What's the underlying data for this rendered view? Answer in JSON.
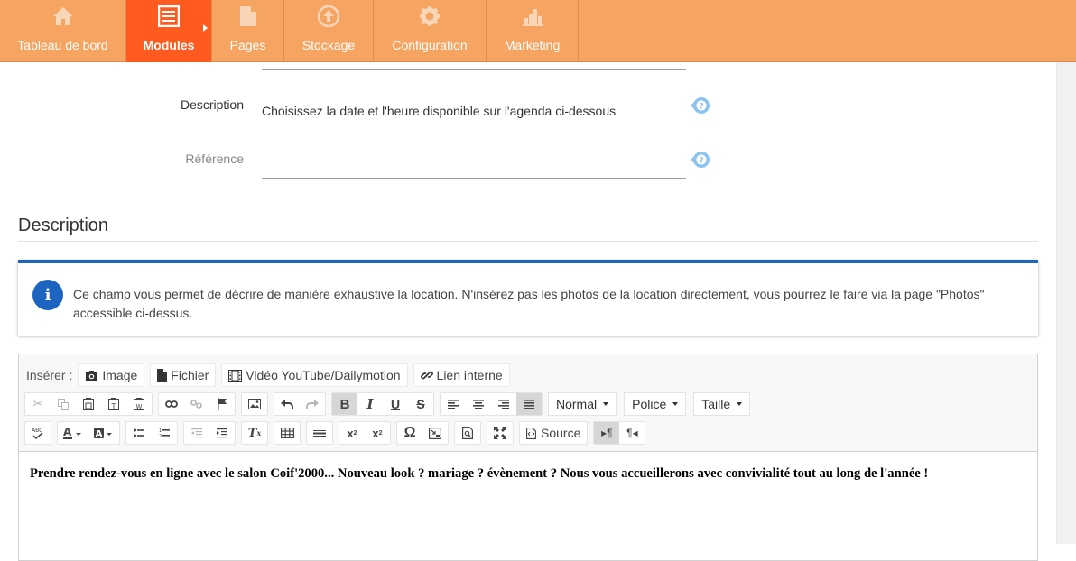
{
  "nav": {
    "items": [
      {
        "label": "Tableau de bord",
        "icon": "home-icon"
      },
      {
        "label": "Modules",
        "icon": "modules-list-icon",
        "active": true
      },
      {
        "label": "Pages",
        "icon": "page-icon"
      },
      {
        "label": "Stockage",
        "icon": "upload-icon"
      },
      {
        "label": "Configuration",
        "icon": "gear-icon"
      },
      {
        "label": "Marketing",
        "icon": "bar-chart-icon"
      }
    ],
    "bg_color": "#f5a462",
    "active_color": "#ff5a1f"
  },
  "form": {
    "description_label": "Description",
    "description_value": "Choisissez la date et l'heure disponible sur l'agenda ci-dessous",
    "reference_label": "Référence",
    "reference_value": ""
  },
  "section": {
    "title": "Description"
  },
  "alert": {
    "text": "Ce champ vous permet de décrire de manière exhaustive la location. N'insérez pas les photos de la location directement, vous pourrez le faire via la page \"Photos\" accessible ci-dessus.",
    "accent_color": "#1d63c0"
  },
  "editor": {
    "insert_label": "Insérer :",
    "insert_buttons": {
      "image": "Image",
      "file": "Fichier",
      "video": "Vidéo YouTube/Dailymotion",
      "link": "Lien interne"
    },
    "format_combo": "Normal",
    "font_combo": "Police",
    "size_combo": "Taille",
    "source_label": "Source",
    "content": "Prendre rendez-vous en ligne avec le salon Coif'2000...  Nouveau look ? mariage ? évènement ? Nous vous accueillerons avec convivialité tout au long de l'année !"
  }
}
